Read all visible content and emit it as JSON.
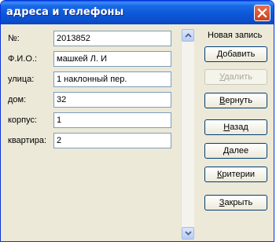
{
  "window": {
    "title": "адреса и телефоны"
  },
  "fields": [
    {
      "label": "№:",
      "value": "2013852"
    },
    {
      "label": "Ф.И.О.:",
      "value": "машкей Л. И"
    },
    {
      "label": "улица:",
      "value": "1 наклонный пер."
    },
    {
      "label": "дом:",
      "value": "32"
    },
    {
      "label": "корпус:",
      "value": "1"
    },
    {
      "label": "квартира:",
      "value": "2"
    }
  ],
  "status": {
    "new_record": "Новая запись"
  },
  "buttons": {
    "add": {
      "mnemonic": "Д",
      "rest": "обавить"
    },
    "delete": {
      "mnemonic": "У",
      "rest": "далить"
    },
    "restore": {
      "mnemonic": "В",
      "rest": "ернуть"
    },
    "back": {
      "mnemonic": "Н",
      "rest": "азад"
    },
    "next": {
      "mnemonic": "Д",
      "rest": "алее"
    },
    "criteria": {
      "mnemonic": "К",
      "rest": "ритерии"
    },
    "close": {
      "mnemonic": "З",
      "rest": "акрыть"
    }
  },
  "icons": {
    "close": "close-icon",
    "scroll_up": "arrow-up-icon",
    "scroll_down": "arrow-down-icon"
  }
}
